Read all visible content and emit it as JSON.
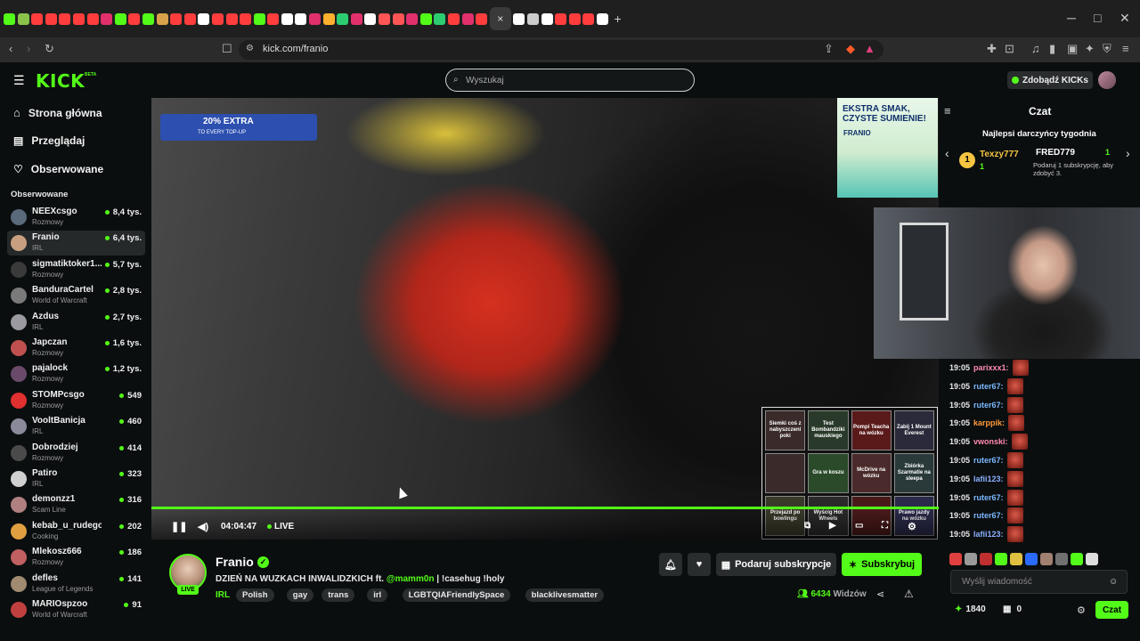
{
  "browser": {
    "url": "kick.com/franio",
    "tab_colors": [
      "#53fc18",
      "#8bc34a",
      "#ff3d3d",
      "#ff3d3d",
      "#ff3d3d",
      "#ff3d3d",
      "#ff3d3d",
      "#e1306c",
      "#53fc18",
      "#ff3d3d",
      "#53fc18",
      "#d8a24a",
      "#ff3d3d",
      "#ff3d3d",
      "#ffffff",
      "#ff3d3d",
      "#ff3d3d",
      "#ff3d3d",
      "#53fc18",
      "#ff3d3d",
      "#ffffff",
      "#ffffff",
      "#e1306c",
      "#ffb02e",
      "#2ecc71",
      "#e1306c",
      "#ffffff",
      "#ff5555",
      "#ff5555",
      "#e1306c",
      "#53fc18",
      "#2ecc71",
      "#ff3d3d",
      "#e1306c",
      "#ff3d3d",
      "#ffffff",
      "#cccccc",
      "#ffffff",
      "#ff3d3d",
      "#ff3d3d",
      "#ff3d3d",
      "#ffffff"
    ],
    "active_tab_icon": "×",
    "new_tab_icon": "+",
    "win_min": "─",
    "win_max": "□",
    "win_close": "✕"
  },
  "header": {
    "logo": "KICK",
    "logo_badge": "BETA",
    "search_placeholder": "Wyszukaj",
    "get_kicks": "Zdobądź KICKs"
  },
  "nav": {
    "home": "Strona główna",
    "browse": "Przeglądaj",
    "following": "Obserwowane"
  },
  "followed": {
    "title": "Obserwowane",
    "channels": [
      {
        "name": "NEEXcsgo",
        "category": "Rozmowy",
        "viewers": "8,4 tys.",
        "color": "#5a6a7a"
      },
      {
        "name": "Franio",
        "category": "IRL",
        "viewers": "6,4 tys.",
        "color": "#c8a080"
      },
      {
        "name": "sigmatiktoker1...",
        "category": "Rozmowy",
        "viewers": "5,7 tys.",
        "color": "#3a3a3a"
      },
      {
        "name": "BanduraCartel",
        "category": "World of Warcraft",
        "viewers": "2,8 tys.",
        "color": "#7a7a7a"
      },
      {
        "name": "Azdus",
        "category": "IRL",
        "viewers": "2,7 tys.",
        "color": "#9a9aa0"
      },
      {
        "name": "Japczan",
        "category": "Rozmowy",
        "viewers": "1,6 tys.",
        "color": "#c05050"
      },
      {
        "name": "pajalock",
        "category": "Rozmowy",
        "viewers": "1,2 tys.",
        "color": "#6a4a6a"
      },
      {
        "name": "STOMPcsgo",
        "category": "Rozmowy",
        "viewers": "549",
        "color": "#e03030"
      },
      {
        "name": "VooltBanicja",
        "category": "IRL",
        "viewers": "460",
        "color": "#8a8a9a"
      },
      {
        "name": "Dobrodziej",
        "category": "Rozmowy",
        "viewers": "414",
        "color": "#4a4a4a"
      },
      {
        "name": "Patiro",
        "category": "IRL",
        "viewers": "323",
        "color": "#d0d0d0"
      },
      {
        "name": "demonzz1",
        "category": "Scam Line",
        "viewers": "316",
        "color": "#b08080"
      },
      {
        "name": "kebab_u_rudego",
        "category": "Cooking",
        "viewers": "202",
        "color": "#e0a040"
      },
      {
        "name": "Mlekosz666",
        "category": "Rozmowy",
        "viewers": "186",
        "color": "#c06060"
      },
      {
        "name": "defles",
        "category": "League of Legends",
        "viewers": "141",
        "color": "#a08a70"
      },
      {
        "name": "MARIOspzoo",
        "category": "World of Warcraft",
        "viewers": "91",
        "color": "#c04040"
      }
    ]
  },
  "video": {
    "promo": "20% EXTRA",
    "promo_sub": "TO EVERY TOP-UP",
    "ad_head": "EKSTRA SMAK, CZYSTE SUMIENIE!",
    "ad_brand": "FRANIO",
    "time": "04:04:47",
    "live": "LIVE",
    "soundboard": [
      "Siemki coś z nabyszczeni poki",
      "Test Bombandziki mauskiego",
      "Pompi Teacha na wózku",
      "Zabij 1 Mount Everest",
      "",
      "Gra w koszu",
      "McDrive na wózku",
      "Zbiórka Szarmatie na sleepa",
      "Przejazd po bowlingu",
      "Wyścig Hot Wheels",
      "",
      "Prawo jazdy na wózku"
    ]
  },
  "stream": {
    "name": "Franio",
    "live_badge": "LIVE",
    "title_main": "DZIEŃ NA WUZKACH INWALIDZKICH ft.",
    "title_mention": "@mamm0n",
    "title_rest": "| !casehug !holy",
    "category": "IRL",
    "tags": [
      "Polish",
      "gay",
      "trans",
      "irl",
      "LGBTQIAFriendlySpace",
      "blacklivesmatter"
    ],
    "gift_sub": "Podaruj subskrypcje",
    "subscribe": "Subskrybuj",
    "viewers_count": "6434",
    "viewers_label": "Widzów"
  },
  "chat": {
    "title": "Czat",
    "gifters_title": "Najlepsi darczyńcy tygodnia",
    "gifter1_rank": "1",
    "gifter1_name": "Texzy777",
    "gifter1_count": "1",
    "gifter2_name": "FRED779",
    "gifter2_count": "1",
    "gifter2_note": "Podaruj 1 subskrypcję, aby zdobyć 3.",
    "messages": [
      {
        "time": "19:05",
        "user": "parixxx1",
        "color": "#ff8ab0"
      },
      {
        "time": "19:05",
        "user": "ruter67",
        "color": "#7ab8ff"
      },
      {
        "time": "19:05",
        "user": "ruter67",
        "color": "#7ab8ff"
      },
      {
        "time": "19:05",
        "user": "karppik",
        "color": "#ff9a3a"
      },
      {
        "time": "19:05",
        "user": "vwonski",
        "color": "#ff8ab0"
      },
      {
        "time": "19:05",
        "user": "ruter67",
        "color": "#7ab8ff"
      },
      {
        "time": "19:05",
        "user": "lafii123",
        "color": "#8ab0ff"
      },
      {
        "time": "19:05",
        "user": "ruter67",
        "color": "#7ab8ff"
      },
      {
        "time": "19:05",
        "user": "ruter67",
        "color": "#7ab8ff"
      },
      {
        "time": "19:05",
        "user": "lafii123",
        "color": "#8ab0ff"
      }
    ],
    "emote_colors": [
      "#e04040",
      "#9a9a9a",
      "#c03030",
      "#53fc18",
      "#e0c040",
      "#2a6aff",
      "#a08070",
      "#707070",
      "#53fc18",
      "#dddddd"
    ],
    "input_placeholder": "Wyślij wiadomość",
    "kicks_count": "1840",
    "points_count": "0",
    "send_button": "Czat"
  }
}
